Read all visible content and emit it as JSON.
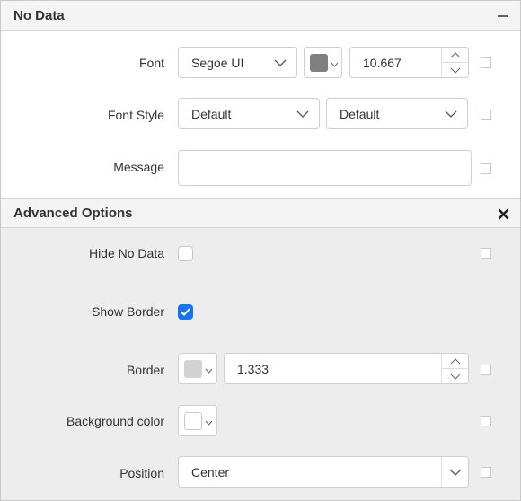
{
  "no_data": {
    "title": "No Data",
    "font_label": "Font",
    "font_family": "Segoe UI",
    "font_color": "#808080",
    "font_size": "10.667",
    "font_style_label": "Font Style",
    "font_style": "Default",
    "font_weight": "Default",
    "message_label": "Message",
    "message_value": ""
  },
  "advanced": {
    "title": "Advanced Options",
    "hide_no_data_label": "Hide No Data",
    "hide_no_data_checked": false,
    "show_border_label": "Show Border",
    "show_border_checked": true,
    "border_label": "Border",
    "border_color": "#d3d3d3",
    "border_width": "1.333",
    "bg_color_label": "Background color",
    "bg_color": "#ffffff",
    "position_label": "Position",
    "position": "Center"
  },
  "colors": {
    "accent": "#1a73e8"
  }
}
